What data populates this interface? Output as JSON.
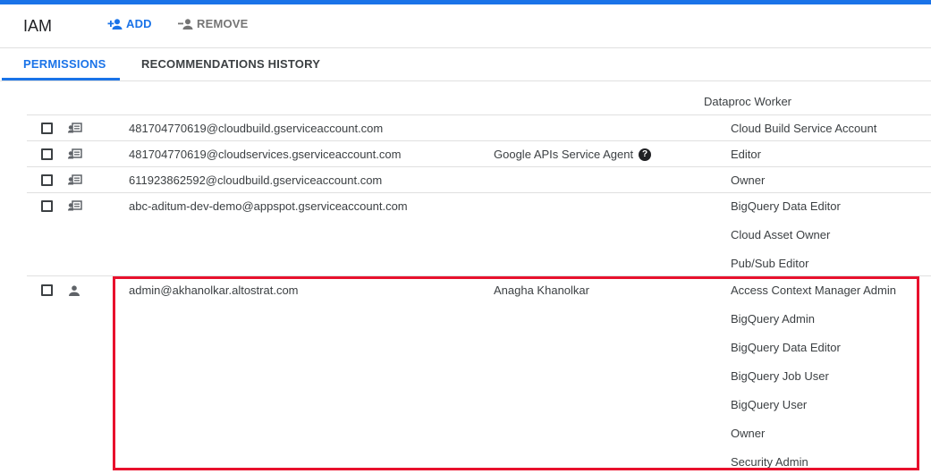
{
  "header": {
    "title": "IAM",
    "add_label": "ADD",
    "remove_label": "REMOVE"
  },
  "tabs": [
    {
      "label": "PERMISSIONS",
      "active": true
    },
    {
      "label": "RECOMMENDATIONS HISTORY",
      "active": false
    }
  ],
  "table": {
    "partial_role": "Dataproc Worker",
    "rows": [
      {
        "type": "service-account",
        "member": "481704770619@cloudbuild.gserviceaccount.com",
        "name": "",
        "roles": [
          "Cloud Build Service Account"
        ]
      },
      {
        "type": "service-account",
        "member": "481704770619@cloudservices.gserviceaccount.com",
        "name": "Google APIs Service Agent",
        "help": "?",
        "roles": [
          "Editor"
        ]
      },
      {
        "type": "service-account",
        "member": "611923862592@cloudbuild.gserviceaccount.com",
        "name": "",
        "roles": [
          "Owner"
        ]
      },
      {
        "type": "service-account",
        "member": "abc-aditum-dev-demo@appspot.gserviceaccount.com",
        "name": "",
        "roles": [
          "BigQuery Data Editor",
          "Cloud Asset Owner",
          "Pub/Sub Editor"
        ]
      },
      {
        "type": "user",
        "member": "admin@akhanolkar.altostrat.com",
        "name": "Anagha Khanolkar",
        "roles": [
          "Access Context Manager Admin",
          "BigQuery Admin",
          "BigQuery Data Editor",
          "BigQuery Job User",
          "BigQuery User",
          "Owner",
          "Security Admin"
        ]
      }
    ]
  },
  "colors": {
    "accent": "#1a73e8",
    "highlight": "#e8112d",
    "text": "#3c4043"
  }
}
